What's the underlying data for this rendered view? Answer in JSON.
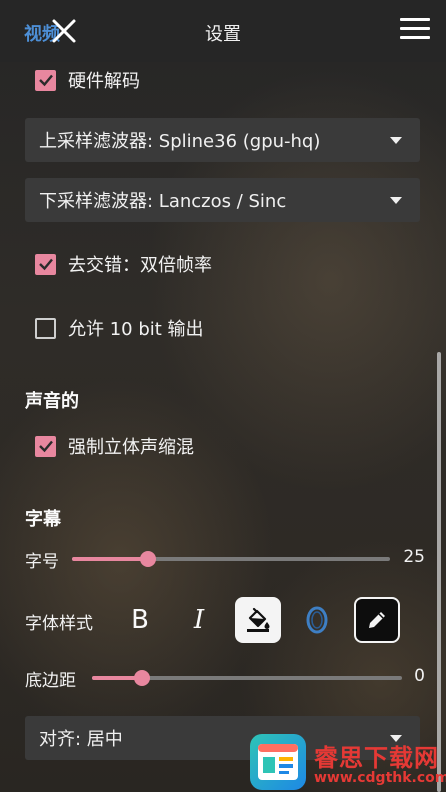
{
  "header": {
    "ghost_text": "视频",
    "title": "设置",
    "close_icon": "close-icon",
    "menu_icon": "hamburger-menu-icon"
  },
  "video": {
    "hw_decode": {
      "label": "硬件解码",
      "checked": true
    },
    "upscale_filter": {
      "value": "上采样滤波器: Spline36 (gpu-hq)"
    },
    "downscale_filter": {
      "value": "下采样滤波器: Lanczos / Sinc"
    },
    "deinterlace": {
      "label": "去交错：双倍帧率",
      "checked": true
    },
    "allow_10bit": {
      "label": "允许 10 bit 输出",
      "checked": false
    }
  },
  "audio": {
    "section_title": "声音的",
    "downmix": {
      "label": "强制立体声缩混",
      "checked": true
    }
  },
  "subtitles": {
    "section_title": "字幕",
    "font_size": {
      "label": "字号",
      "value": "25",
      "fraction": 0.24
    },
    "font_style": {
      "label": "字体样式",
      "bold": "B",
      "italic": "I",
      "buttons": [
        "bold",
        "italic",
        "fill-color",
        "outline",
        "pen"
      ]
    },
    "bottom_margin": {
      "label": "底边距",
      "value": "0",
      "fraction": 0.16
    },
    "alignment": {
      "value": "对齐: 居中"
    }
  },
  "watermark": {
    "title": "睿思下载网",
    "url": "www.cdgthk.com"
  },
  "colors": {
    "accent": "#e8879f",
    "panel": "#3a3a3a",
    "watermark": "#e53935"
  }
}
